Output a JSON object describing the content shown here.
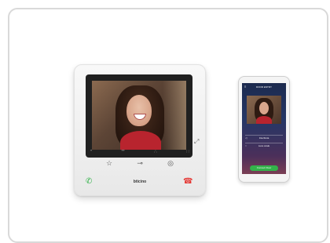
{
  "monitor": {
    "brand": "bticino",
    "icons": {
      "side": "link-icon",
      "key1": "star-icon",
      "key2": "key-icon",
      "key3": "eye-icon",
      "call": "phone-answer-icon",
      "hangup": "phone-hangup-icon"
    }
  },
  "phone": {
    "title": "DOOR ENTRY",
    "row1": "Interfonia",
    "row2": "Luce scale",
    "button": "Connect Door"
  }
}
